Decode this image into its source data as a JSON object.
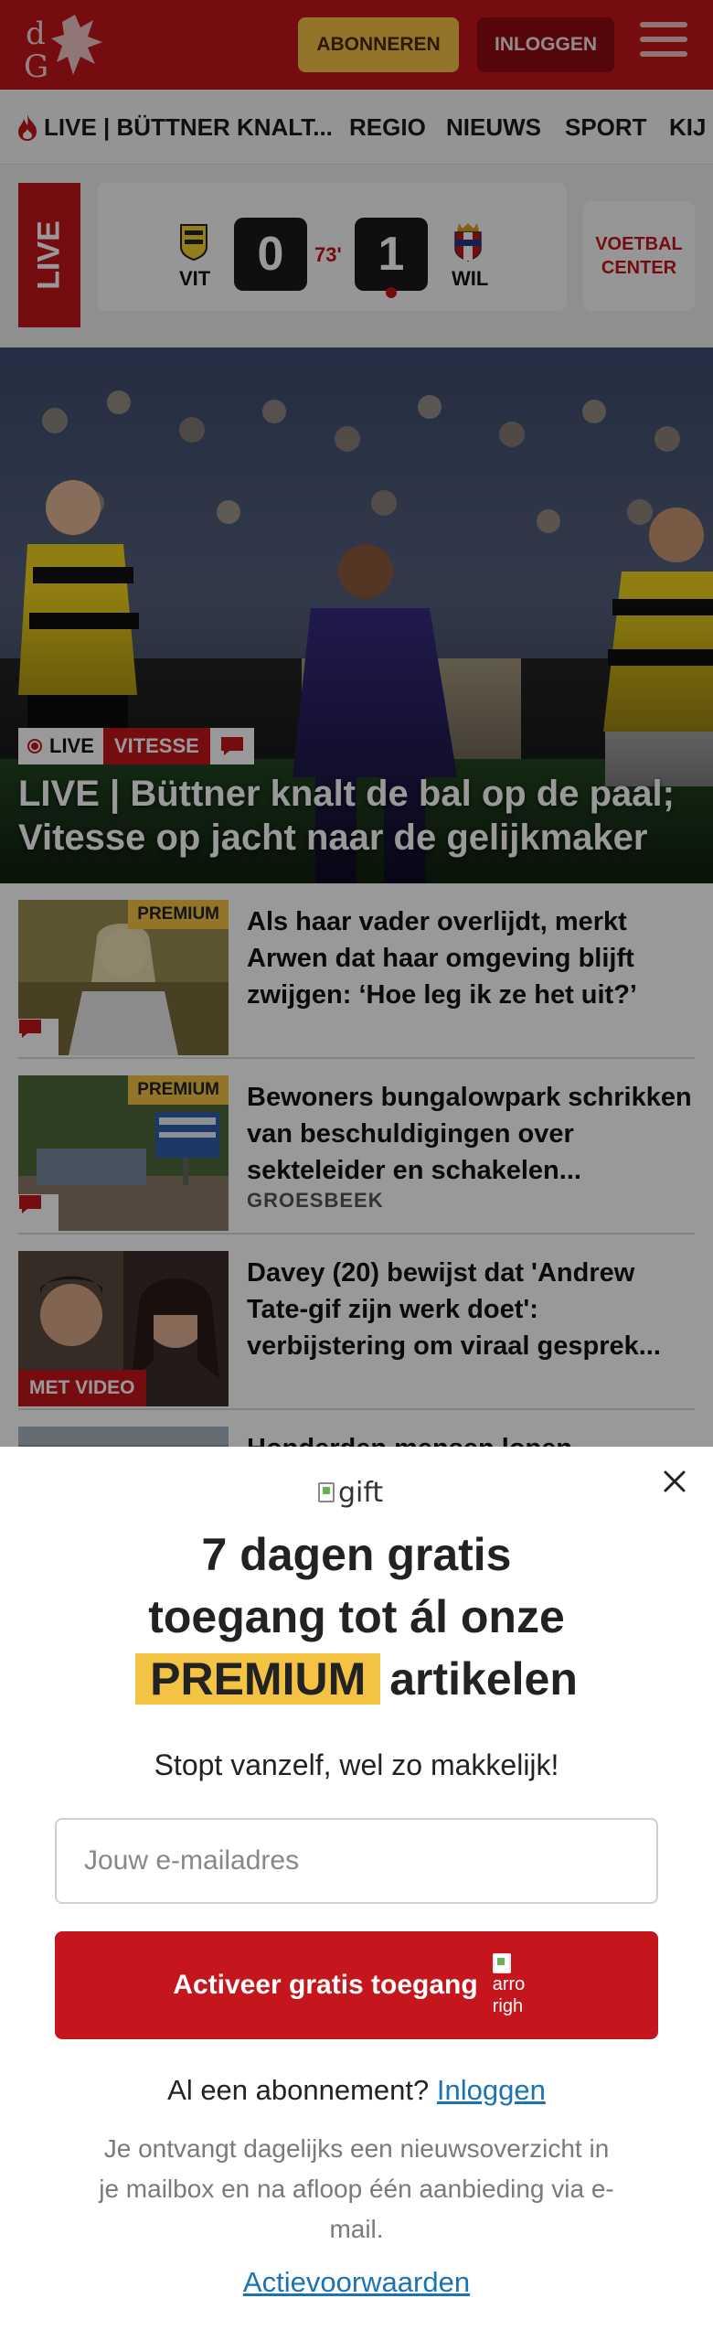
{
  "header": {
    "subscribe_label": "ABONNEREN",
    "login_label": "INLOGGEN",
    "logo_text": "dG"
  },
  "nav": {
    "items": [
      {
        "label": "LIVE | BÜTTNER KNALT..."
      },
      {
        "label": "REGIO"
      },
      {
        "label": "NIEUWS"
      },
      {
        "label": "SPORT"
      },
      {
        "label": "KIJ"
      }
    ]
  },
  "scoreboard": {
    "live_label": "LIVE",
    "home_team": "VIT",
    "away_team": "WIL",
    "home_score": "0",
    "away_score": "1",
    "minute": "73'",
    "voetbal_center": "VOETBAL CENTER"
  },
  "hero": {
    "live_tag": "LIVE",
    "club_tag": "VITESSE",
    "title": "LIVE | Büttner knalt de bal op de paal; Vitesse op jacht naar de gelijkmaker"
  },
  "articles": [
    {
      "badge": "PREMIUM",
      "title": "Als haar vader overlijdt, merkt Arwen dat haar omgeving blijft zwijgen: ‘Hoe leg ik ze het uit?’",
      "kicker": ""
    },
    {
      "badge": "PREMIUM",
      "title": "Bewoners bungalowpark schrikken van beschuldigingen over sekteleider en schakelen...",
      "kicker": "GROESBEEK"
    },
    {
      "badge": "MET VIDEO",
      "title": "Davey (20) bewijst dat 'Andrew Tate-gif zijn werk doet': verbijstering om viraal gesprek...",
      "kicker": ""
    },
    {
      "badge": "",
      "title": "Honderden mensen lopen",
      "kicker": ""
    }
  ],
  "modal": {
    "gift_alt": "gift",
    "title_line1": "7 dagen gratis",
    "title_line2": "toegang tot ál onze",
    "title_highlight": "PREMIUM",
    "title_line3_rest": "artikelen",
    "subtitle": "Stopt vanzelf, wel zo makkelijk!",
    "email_placeholder": "Jouw e-mailadres",
    "cta_label": "Activeer gratis toegang",
    "cta_arrow_alt": "arrow-right",
    "cta_arrow_alt_text": "arro righ",
    "login_prompt": "Al een abonnement?",
    "login_link": "Inloggen",
    "note": "Je ontvangt dagelijks een nieuwsoverzicht in je mailbox en na afloop één aanbieding via e-mail.",
    "terms_link": "Actievoorwaarden"
  },
  "colors": {
    "brand_red": "#c4161c",
    "premium_yellow": "#f4c343",
    "link_blue": "#1a73b5"
  }
}
